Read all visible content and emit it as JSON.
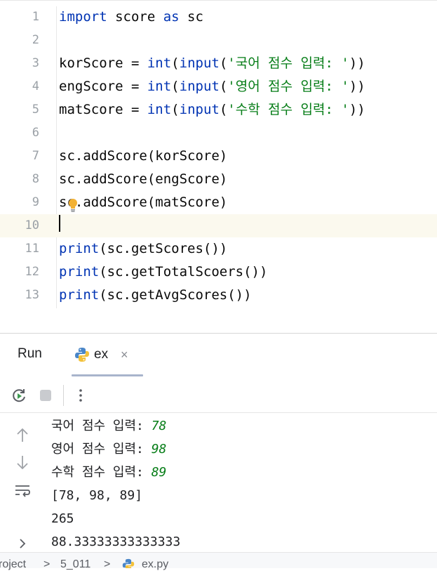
{
  "editor": {
    "lines": [
      {
        "num": "1",
        "t1": "import",
        "t2": " score ",
        "t3": "as",
        "t4": " sc"
      },
      {
        "num": "2"
      },
      {
        "num": "3",
        "v": "korScore = ",
        "f1": "int",
        "p1": "(",
        "f2": "input",
        "p2": "(",
        "s": "'국어 점수 입력: '",
        "e": "))"
      },
      {
        "num": "4",
        "v": "engScore = ",
        "f1": "int",
        "p1": "(",
        "f2": "input",
        "p2": "(",
        "s": "'영어 점수 입력: '",
        "e": "))"
      },
      {
        "num": "5",
        "v": "matScore = ",
        "f1": "int",
        "p1": "(",
        "f2": "input",
        "p2": "(",
        "s": "'수학 점수 입력: '",
        "e": "))"
      },
      {
        "num": "6"
      },
      {
        "num": "7",
        "code": "sc.addScore(korScore)"
      },
      {
        "num": "8",
        "code": "sc.addScore(engScore)"
      },
      {
        "num": "9",
        "code": "sc.addScore(matScore)"
      },
      {
        "num": "10"
      },
      {
        "num": "11",
        "f": "print",
        "rest": "(sc.getScores())"
      },
      {
        "num": "12",
        "f": "print",
        "rest": "(sc.getTotalScoers())"
      },
      {
        "num": "13",
        "f": "print",
        "rest": "(sc.getAvgScores())"
      }
    ]
  },
  "run_panel": {
    "title": "Run",
    "tab_label": "ex",
    "tab_close": "×",
    "output": [
      {
        "prompt": "국어 점수 입력: ",
        "input": "78"
      },
      {
        "prompt": "영어 점수 입력: ",
        "input": "98"
      },
      {
        "prompt": "수학 점수 입력: ",
        "input": "89"
      },
      {
        "text": "[78, 98, 89]"
      },
      {
        "text": "265"
      },
      {
        "text": "88.33333333333333"
      }
    ]
  },
  "statusbar": {
    "project": "roject",
    "sep": ">",
    "folder": "5_011",
    "file": "ex.py"
  },
  "colors": {
    "keyword": "#0033b3",
    "string": "#067d17",
    "user_input": "#067d17",
    "current_line": "#fbf9ee"
  },
  "icons": [
    "lightbulb-icon",
    "python-icon",
    "rerun-icon",
    "stop-icon",
    "more-icon",
    "arrow-up-icon",
    "arrow-down-icon",
    "soft-wrap-icon",
    "chevron-right-icon"
  ]
}
